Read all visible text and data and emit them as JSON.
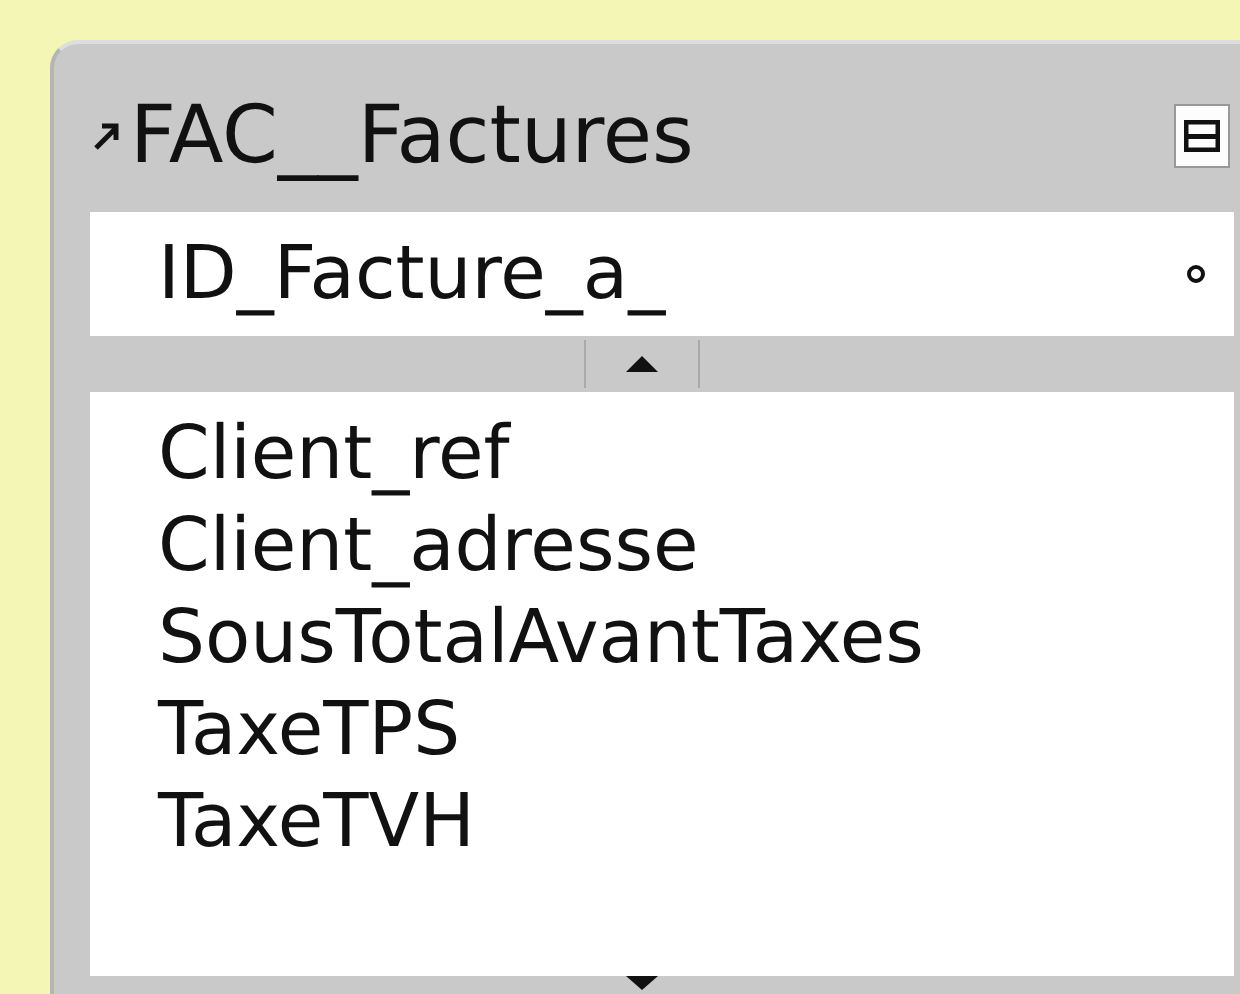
{
  "table": {
    "name": "FAC__Factures",
    "key_fields": [
      {
        "name": "ID_Facture_a_"
      }
    ],
    "fields": [
      {
        "name": "Client_ref"
      },
      {
        "name": "Client_adresse"
      },
      {
        "name": "SousTotalAvantTaxes"
      },
      {
        "name": "TaxeTPS"
      },
      {
        "name": "TaxeTVH"
      }
    ]
  }
}
